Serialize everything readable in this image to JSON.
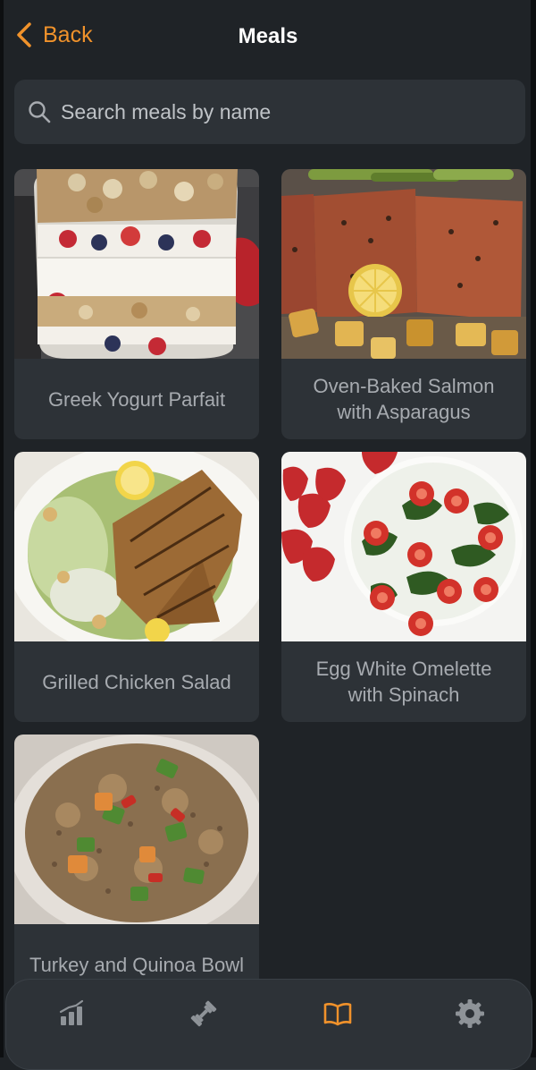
{
  "header": {
    "back_label": "Back",
    "title": "Meals"
  },
  "search": {
    "placeholder": "Search meals by name",
    "value": ""
  },
  "meals": [
    {
      "name": "Greek Yogurt Parfait"
    },
    {
      "name": "Oven-Baked Salmon with Asparagus"
    },
    {
      "name": "Grilled Chicken Salad"
    },
    {
      "name": "Egg White Omelette with Spinach"
    },
    {
      "name": "Turkey and Quinoa Bowl"
    }
  ],
  "tabbar": {
    "tabs": [
      {
        "icon": "chart-icon",
        "active": false
      },
      {
        "icon": "dumbbell-icon",
        "active": false
      },
      {
        "icon": "book-icon",
        "active": true
      },
      {
        "icon": "gear-icon",
        "active": false
      }
    ]
  },
  "colors": {
    "accent": "#f0922b",
    "background": "#1f2327",
    "card": "#2d3237",
    "card_text": "#a7abb0",
    "inactive_icon": "#8e9398"
  }
}
